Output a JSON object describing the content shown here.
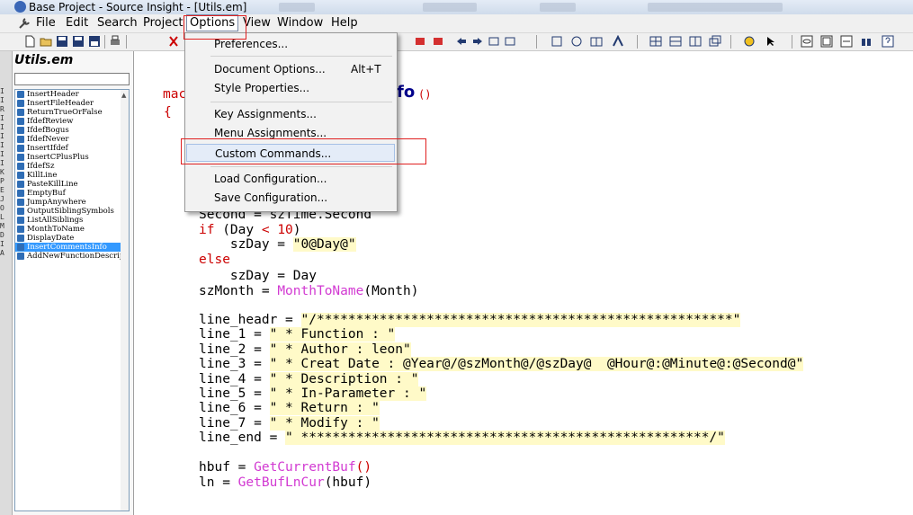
{
  "window": {
    "title": "Base Project - Source Insight - [Utils.em]"
  },
  "menubar": {
    "items": [
      "File",
      "Edit",
      "Search",
      "Project",
      "Options",
      "View",
      "Window",
      "Help"
    ],
    "active": "Options"
  },
  "options_menu": {
    "items": [
      {
        "label": "Preferences...",
        "shortcut": ""
      },
      {
        "label": "Document Options...",
        "shortcut": "Alt+T"
      },
      {
        "label": "Style Properties...",
        "shortcut": ""
      },
      {
        "label": "Key Assignments...",
        "shortcut": ""
      },
      {
        "label": "Menu Assignments...",
        "shortcut": ""
      },
      {
        "label": "Custom Commands...",
        "shortcut": ""
      },
      {
        "label": "Load Configuration...",
        "shortcut": ""
      },
      {
        "label": "Save Configuration...",
        "shortcut": ""
      }
    ],
    "highlighted": "Custom Commands..."
  },
  "sidebar": {
    "title": "Utils.em",
    "symbols": [
      "InsertHeader",
      "InsertFileHeader",
      "ReturnTrueOrFalse",
      "IfdefReview",
      "IfdefBogus",
      "IfdefNever",
      "InsertIfdef",
      "InsertCPlusPlus",
      "IfdefSz",
      "KillLine",
      "PasteKillLine",
      "EmptyBuf",
      "JumpAnywhere",
      "OutputSiblingSymbols",
      "ListAllSiblings",
      "MonthToName",
      "DisplayDate",
      "InsertCommentsInfo",
      "AddNewFunctionDescription"
    ],
    "selected": "InsertCommentsInfo",
    "left_strip_letters": [
      "I",
      "I",
      "R",
      "I",
      "I",
      "I",
      "I",
      "I",
      "I",
      "K",
      "P",
      "E",
      "J",
      "O",
      "L",
      "M",
      "D",
      "I",
      "A"
    ]
  },
  "editor": {
    "macro_kw": "mac",
    "brace": "{",
    "func_name_tail": "fo",
    "func_parens": "()",
    "lines": {
      "second_var": "Second = ",
      "second_val": "szTime.Second",
      "if_kw": "if",
      "if_cond_a": " (Day ",
      "if_cond_op": "< 10",
      "if_cond_b": ")",
      "szday1_a": "    szDay = ",
      "szday1_str": "\"0@Day@\"",
      "else_kw": "else",
      "szday2": "    szDay = Day",
      "szmonth_a": "szMonth = ",
      "szmonth_fn": "MonthToName",
      "szmonth_b": "(Month)",
      "lh_var": "line_headr = ",
      "lh_str": "\"/*****************************************************\"",
      "l1_var": "line_1 = ",
      "l1_str": "\" * Function : \"",
      "l2_var": "line_2 = ",
      "l2_str": "\" * Author : leon\"",
      "l3_var": "line_3 = ",
      "l3_str": "\" * Creat Date : @Year@/@szMonth@/@szDay@  @Hour@:@Minute@:@Second@\"",
      "l4_var": "line_4 = ",
      "l4_str": "\" * Description : \"",
      "l5_var": "line_5 = ",
      "l5_str": "\" * In-Parameter : \"",
      "l6_var": "line_6 = ",
      "l6_str": "\" * Return : \"",
      "l7_var": "line_7 = ",
      "l7_str": "\" * Modify : \"",
      "le_var": "line_end = ",
      "le_str": "\" ****************************************************/\"",
      "hbuf_a": "hbuf = ",
      "hbuf_fn": "GetCurrentBuf",
      "hbuf_b": "()",
      "ln_a": "ln = ",
      "ln_fn": "GetBufLnCur",
      "ln_b": "(hbuf)"
    }
  }
}
